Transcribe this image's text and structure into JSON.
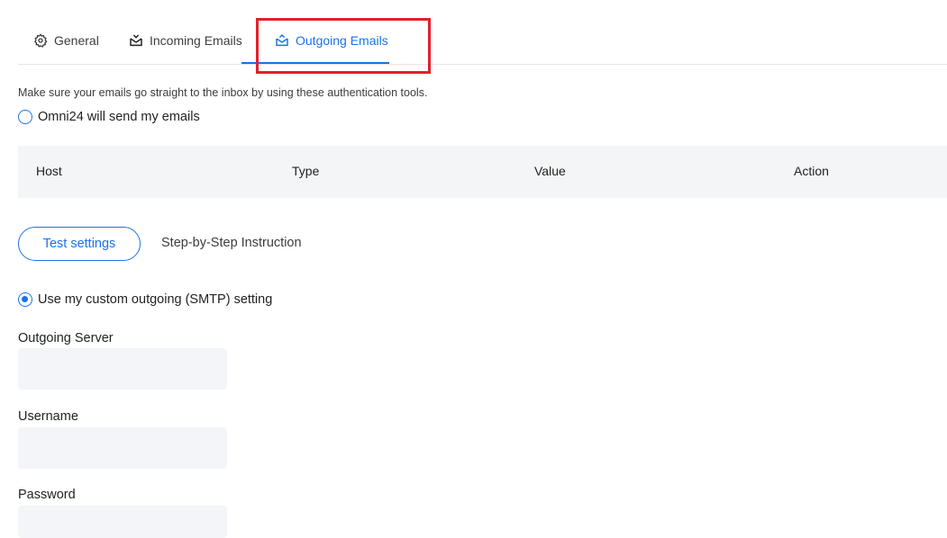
{
  "tabs": [
    {
      "label": "General",
      "icon": "gear-icon"
    },
    {
      "label": "Incoming Emails",
      "icon": "inbox-icon"
    },
    {
      "label": "Outgoing Emails",
      "icon": "outbox-icon",
      "active": true
    }
  ],
  "hint": "Make sure your emails go straight to the inbox by using these authentication tools.",
  "option_omni": "Omni24 will send my emails",
  "table": {
    "columns": [
      "Host",
      "Type",
      "Value",
      "Action"
    ]
  },
  "actions": {
    "test_settings": "Test settings",
    "step_by_step": "Step-by-Step Instruction"
  },
  "option_custom": "Use my custom outgoing (SMTP) setting",
  "fields": {
    "server_label": "Outgoing Server",
    "server_value": "",
    "username_label": "Username",
    "username_value": "",
    "password_label": "Password",
    "password_value": ""
  },
  "colors": {
    "accent": "#1a73e8",
    "highlight_box": "#e0212b",
    "table_header_bg": "#f4f5f7",
    "input_bg": "#f3f5f8"
  }
}
